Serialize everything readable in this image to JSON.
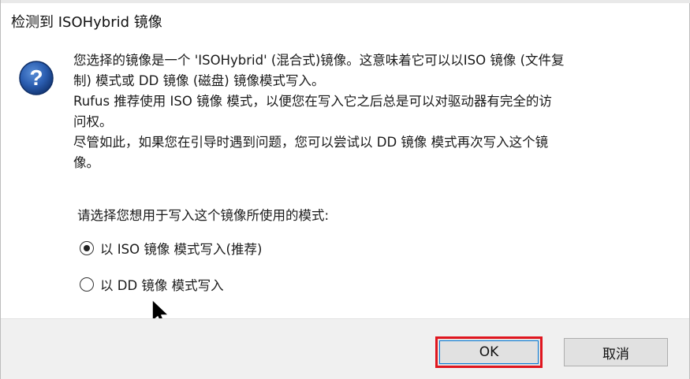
{
  "dialog": {
    "title": "检测到 ISOHybrid 镜像"
  },
  "icons": {
    "question": "question-icon",
    "cursor": "mouse-pointer-icon"
  },
  "message": {
    "lines": [
      "您选择的镜像是一个 'ISOHybrid' (混合式)镜像。这意味着它可以以ISO 镜像 (文件复",
      "制) 模式或 DD 镜像 (磁盘) 镜像模式写入。",
      "Rufus 推荐使用 ISO 镜像 模式，以便您在写入它之后总是可以对驱动器有完全的访",
      "问权。",
      "尽管如此，如果您在引导时遇到问题，您可以尝试以 DD 镜像 模式再次写入这个镜",
      "像。"
    ]
  },
  "prompt": "请选择您想用于写入这个镜像所使用的模式:",
  "options": [
    {
      "label": "以 ISO 镜像 模式写入(推荐)",
      "selected": true
    },
    {
      "label": "以 DD 镜像 模式写入",
      "selected": false
    }
  ],
  "buttons": {
    "ok": "OK",
    "cancel": "取消"
  },
  "colors": {
    "highlight_border": "#e0161f",
    "focus_border": "#0078d7",
    "footer_bg": "#f0f0f0",
    "button_bg": "#e1e1e1"
  }
}
